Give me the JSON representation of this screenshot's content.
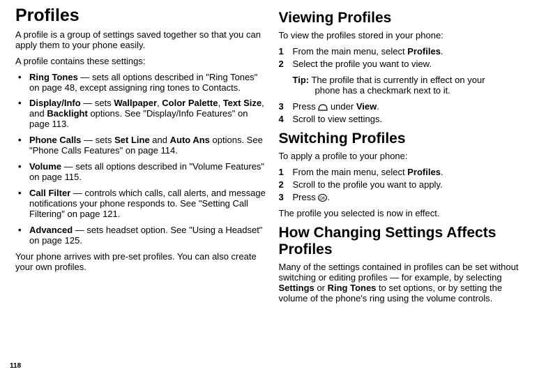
{
  "page_number": "118",
  "left": {
    "h1": "Profiles",
    "intro1": "A profile is a group of settings saved together so that you can apply them to your phone easily.",
    "intro2": "A profile contains these settings:",
    "bullets": [
      {
        "lead": "Ring Tones",
        "rest": " — sets all options described in \"Ring Tones\" on page 48, except assigning ring tones to Contacts."
      },
      {
        "lead": "Display/Info",
        "rest_pre": " — sets ",
        "b1": "Wallpaper",
        "sep1": ", ",
        "b2": "Color Palette",
        "sep2": ", ",
        "b3": "Text Size",
        "sep3": ", and ",
        "b4": "Backlight",
        "rest_post": " options. See \"Display/Info Features\" on page 113."
      },
      {
        "lead": "Phone Calls",
        "rest_pre": " — sets ",
        "b1": "Set Line",
        "sep1": " and ",
        "b2": "Auto Ans",
        "rest_post": " options. See \"Phone Calls Features\" on page 114."
      },
      {
        "lead": "Volume",
        "rest": " — sets all options described in \"Volume Features\" on page 115."
      },
      {
        "lead": "Call Filter",
        "rest": " — controls which calls, call alerts, and message notifications your phone responds to. See \"Setting Call Filtering\" on page 121."
      },
      {
        "lead": "Advanced",
        "rest": " — sets headset option. See \"Using a Headset\" on page 125."
      }
    ],
    "outro": "Your phone arrives with pre-set profiles. You can also create your own profiles."
  },
  "right": {
    "h2a": "Viewing Profiles",
    "view_intro": "To view the profiles stored in your phone:",
    "view_steps": [
      {
        "n": "1",
        "pre": "From the main menu, select ",
        "b": "Profiles",
        "post": "."
      },
      {
        "n": "2",
        "text": "Select the profile you want to view."
      }
    ],
    "tip_label": "Tip:",
    "tip_first": " The profile that is currently in effect on your",
    "tip_cont": "phone has a checkmark next to it.",
    "view_steps2": [
      {
        "n": "3",
        "pre": "Press ",
        "key": "softkey",
        "mid": " under ",
        "b": "View",
        "post": "."
      },
      {
        "n": "4",
        "text": "Scroll to view settings."
      }
    ],
    "h2b": "Switching Profiles",
    "switch_intro": "To apply a profile to your phone:",
    "switch_steps": [
      {
        "n": "1",
        "pre": "From the main menu, select ",
        "b": "Profiles",
        "post": "."
      },
      {
        "n": "2",
        "text": "Scroll to the profile you want to apply."
      },
      {
        "n": "3",
        "pre": "Press ",
        "key": "ok",
        "post": "."
      }
    ],
    "switch_outro": "The profile you selected is now in effect.",
    "h2c": "How Changing Settings Affects Profiles",
    "affects_p_pre": "Many of the settings contained in profiles can be set without switching or editing profiles — for example, by selecting ",
    "affects_b1": "Settings",
    "affects_or": " or ",
    "affects_b2": "Ring Tones",
    "affects_p_post": " to set options, or by setting the volume of the phone's ring using the volume controls."
  }
}
